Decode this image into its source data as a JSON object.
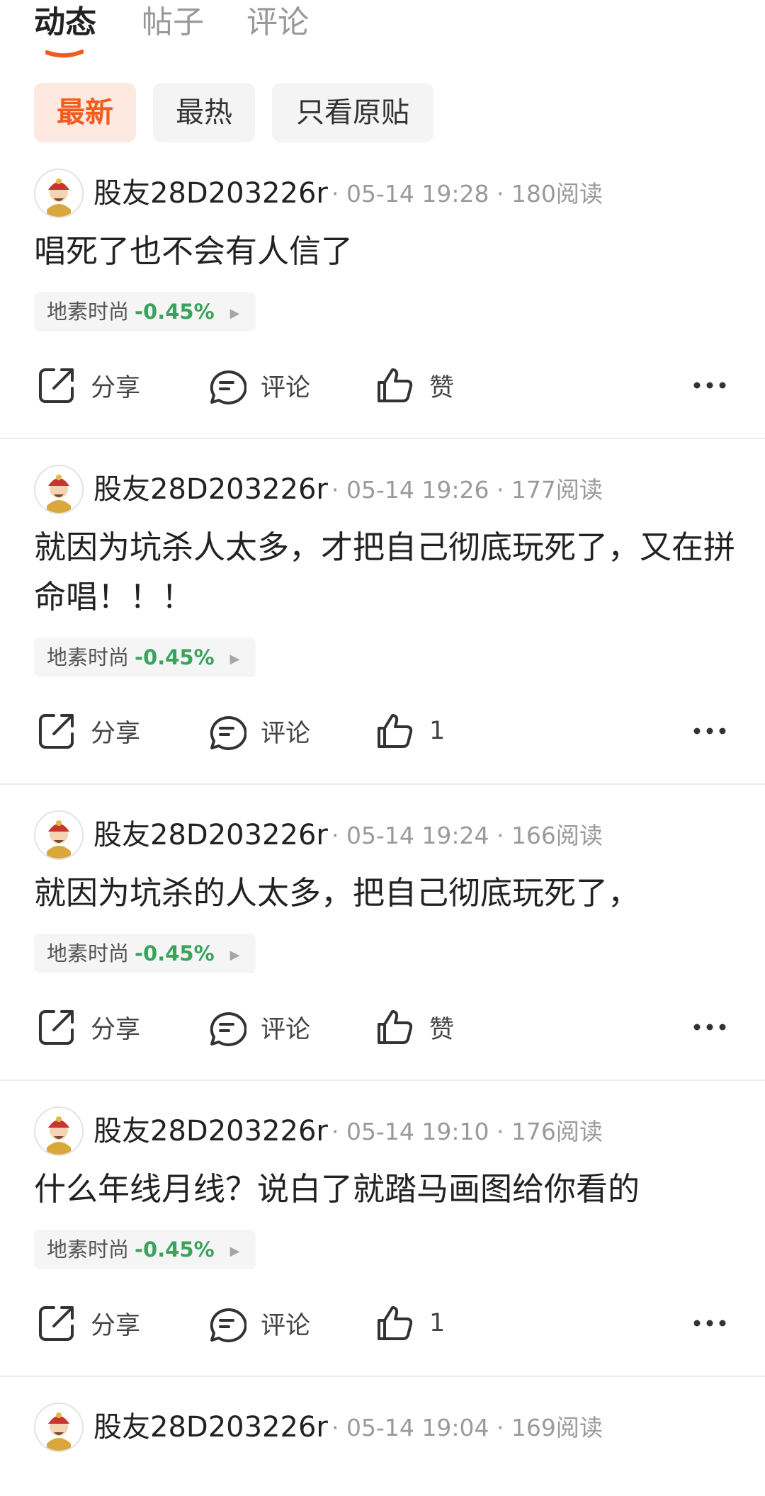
{
  "tabs": [
    {
      "label": "动态",
      "active": true
    },
    {
      "label": "帖子",
      "active": false
    },
    {
      "label": "评论",
      "active": false
    }
  ],
  "filters": [
    {
      "label": "最新",
      "active": true
    },
    {
      "label": "最热",
      "active": false
    },
    {
      "label": "只看原贴",
      "active": false
    }
  ],
  "colors": {
    "accent": "#f25a1e",
    "stock_down": "#3aa35b"
  },
  "actions": {
    "share_label": "分享",
    "comment_label": "评论"
  },
  "posts": [
    {
      "username": "股友28D203226r",
      "meta": "· 05-14 19:28 · 180阅读",
      "content": "唱死了也不会有人信了",
      "stock": {
        "name": "地素时尚",
        "change": "-0.45%"
      },
      "like_label": "赞"
    },
    {
      "username": "股友28D203226r",
      "meta": "· 05-14 19:26 · 177阅读",
      "content": "就因为坑杀人太多，才把自己彻底玩死了，又在拼命唱！！！",
      "stock": {
        "name": "地素时尚",
        "change": "-0.45%"
      },
      "like_label": "1"
    },
    {
      "username": "股友28D203226r",
      "meta": "· 05-14 19:24 · 166阅读",
      "content": "就因为坑杀的人太多，把自己彻底玩死了，",
      "stock": {
        "name": "地素时尚",
        "change": "-0.45%"
      },
      "like_label": "赞"
    },
    {
      "username": "股友28D203226r",
      "meta": "· 05-14 19:10 · 176阅读",
      "content": "什么年线月线？说白了就踏马画图给你看的",
      "stock": {
        "name": "地素时尚",
        "change": "-0.45%"
      },
      "like_label": "1"
    },
    {
      "username": "股友28D203226r",
      "meta": "· 05-14 19:04 · 169阅读"
    }
  ]
}
